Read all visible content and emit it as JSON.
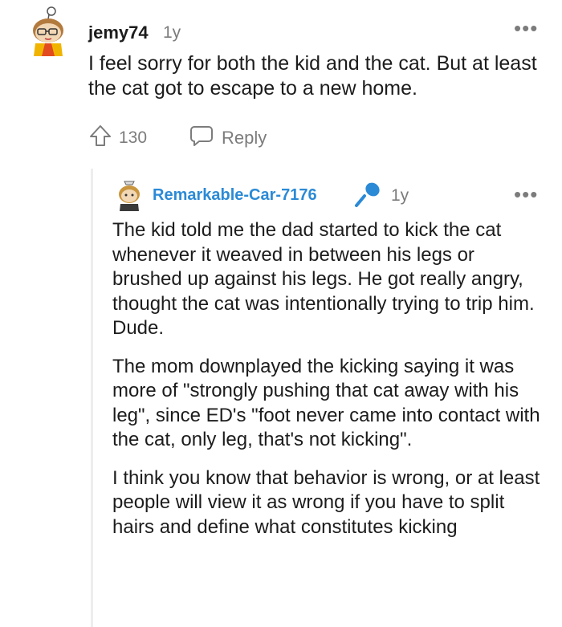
{
  "comment": {
    "username": "jemy74",
    "age": "1y",
    "more_label": "•••",
    "body": "I feel sorry for both the kid and the cat. But at least the cat got to escape to a new home.",
    "votes": "130",
    "reply_label": "Reply"
  },
  "reply_comment": {
    "username": "Remarkable-Car-7176",
    "age": "1y",
    "more_label": "•••",
    "paragraphs": [
      "The kid told me the dad started to kick the cat whenever it weaved in between his legs or brushed up against his legs. He got really angry, thought the cat was intentionally trying to trip him. Dude.",
      "The mom downplayed the kicking saying it was more of \"strongly pushing that cat away with his leg\", since ED's \"foot never came into contact with the cat, only leg, that's not kicking\".",
      "I think you know that behavior is wrong, or at least people will view it as wrong if you have to split hairs and define what constitutes kicking"
    ]
  },
  "icons": {
    "upvote": "upvote-arrow-icon",
    "reply": "speech-bubble-icon",
    "op_badge": "microphone-icon",
    "more": "more-dots-icon"
  },
  "colors": {
    "username_op": "#2b8ad6",
    "meta_gray": "#7c7c7c",
    "text": "#1c1c1c"
  }
}
